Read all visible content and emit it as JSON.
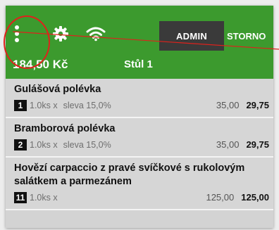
{
  "header": {
    "admin_label": "ADMIN",
    "storno_label": "STORNO",
    "total": "184,50 Kč",
    "table": "Stůl 1"
  },
  "icons": [
    "more-vert-icon",
    "gear-icon",
    "wifi-icon"
  ],
  "colors": {
    "header_bg": "#3c9a2e",
    "admin_bg": "#3a3a3a",
    "annotation": "#e0211c"
  },
  "items": [
    {
      "name": "Gulášová polévka",
      "seq": "1",
      "qty": "1.0ks x",
      "discount": "sleva 15,0%",
      "unit_price": "35,00",
      "total": "29,75"
    },
    {
      "name": "Bramborová polévka",
      "seq": "2",
      "qty": "1.0ks x",
      "discount": "sleva 15,0%",
      "unit_price": "35,00",
      "total": "29,75"
    },
    {
      "name": "Hovězí carpaccio z pravé svíčkové s rukolovým salátkem a parmezánem",
      "seq": "11",
      "qty": "1.0ks x",
      "discount": "",
      "unit_price": "125,00",
      "total": "125,00"
    }
  ]
}
